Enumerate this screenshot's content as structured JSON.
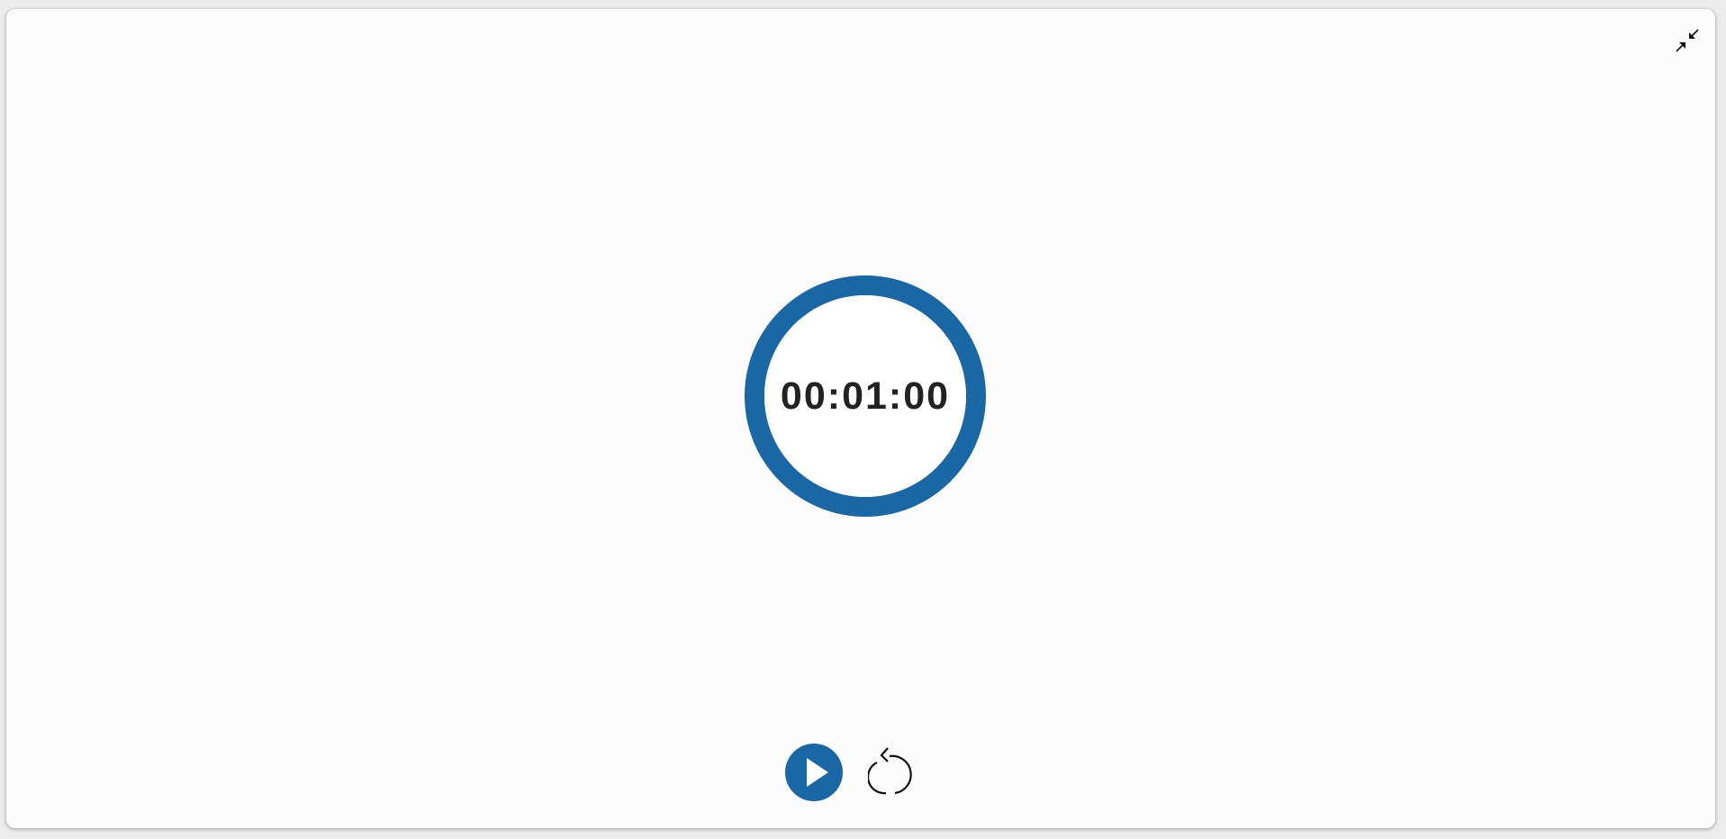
{
  "timer": {
    "display": "00:01:00",
    "progress_fraction": 1.0
  },
  "controls": {
    "play_icon": "play-icon",
    "reset_icon": "reset-icon",
    "fullscreen_icon": "exit-fullscreen-icon"
  },
  "colors": {
    "accent": "#1a67a6",
    "ring_track": "#1a67a6",
    "time_text": "#222222",
    "background": "#fcfcfc"
  }
}
